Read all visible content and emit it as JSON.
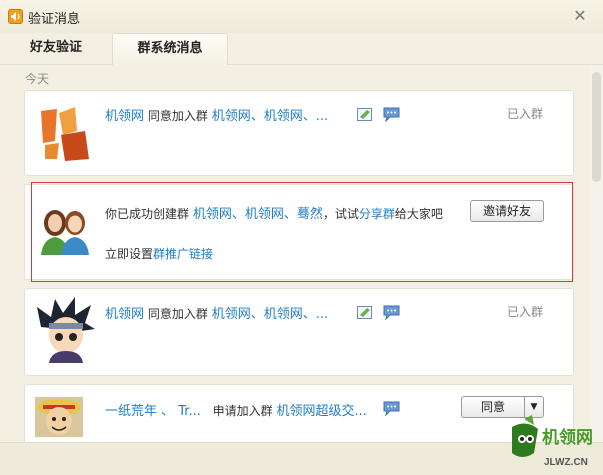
{
  "window": {
    "title": "验证消息",
    "close_glyph": "✕"
  },
  "tabs": [
    {
      "label": "好友验证",
      "active": false
    },
    {
      "label": "群系统消息",
      "active": true
    }
  ],
  "date_label": "今天",
  "messages": [
    {
      "name": "机领网",
      "action": "同意加入群",
      "group": "机领网、机领网、...",
      "status": "已入群",
      "icons": [
        "card-icon",
        "chat-icon"
      ]
    },
    {
      "prefix": "你已成功创建群",
      "group": "机领网、机领网、蓦然",
      "mid": "，试试",
      "share_link": "分享群",
      "suffix": "给大家吧",
      "button": "邀请好友",
      "line2_prefix": "立即设置",
      "line2_link": "群推广链接"
    },
    {
      "name": "机领网",
      "action": "同意加入群",
      "group": "机领网、机领网、...",
      "status": "已入群",
      "icons": [
        "card-icon",
        "chat-icon"
      ]
    },
    {
      "name": "一纸荒年 、 Tr...",
      "action": "申请加入群",
      "group": "机领网超级交...",
      "button": "同意",
      "dropdown_glyph": "▼",
      "icons": [
        "chat-icon"
      ]
    }
  ],
  "watermark": {
    "brand": "机领网",
    "url": "JLWZ.CN"
  },
  "colors": {
    "link": "#1f7dc4",
    "highlight": "#d63a3a",
    "background": "#f3f0e3"
  }
}
